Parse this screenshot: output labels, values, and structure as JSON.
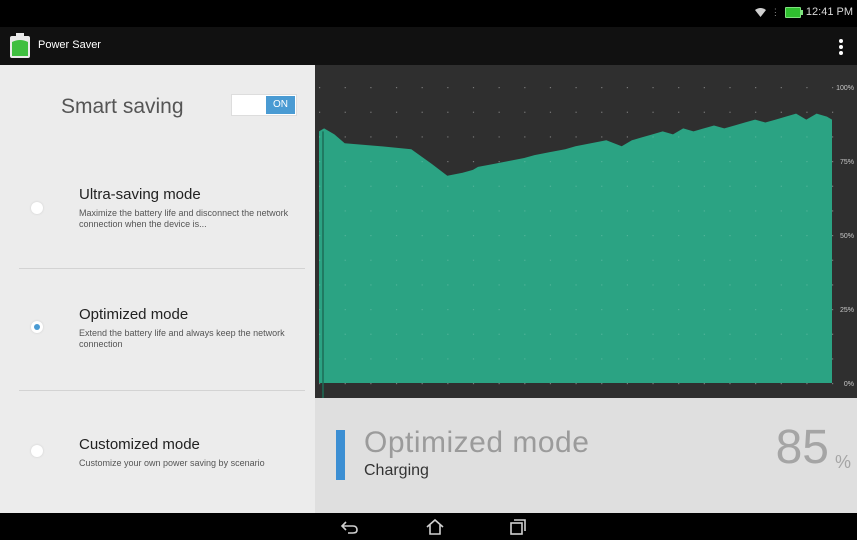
{
  "status_bar": {
    "time": "12:41 PM",
    "icons": [
      "wifi-icon",
      "battery-charging-icon"
    ]
  },
  "app": {
    "title": "Power Saver",
    "icon": "battery-app-icon"
  },
  "smart_saving": {
    "label": "Smart saving",
    "toggle_label": "ON",
    "enabled": true
  },
  "modes": [
    {
      "title": "Ultra-saving mode",
      "description": "Maximize the battery life and disconnect the network connection when the device is...",
      "selected": false
    },
    {
      "title": "Optimized mode",
      "description": "Extend the battery life and always keep the network connection",
      "selected": true
    },
    {
      "title": "Customized mode",
      "description": "Customize your own power saving by scenario",
      "selected": false
    }
  ],
  "chart_data": {
    "type": "area",
    "y_ticks": [
      "100%",
      "75%",
      "50%",
      "25%",
      "0%"
    ],
    "ylim": [
      0,
      100
    ],
    "xlim": [
      0,
      100
    ],
    "grid": true,
    "series": [
      {
        "x": [
          0,
          1,
          3,
          5,
          12,
          18,
          22,
          25,
          28,
          30,
          31,
          34,
          37,
          40,
          42,
          45,
          48,
          50,
          53,
          56,
          59,
          61,
          63,
          65,
          67,
          69,
          71,
          73,
          75,
          77,
          79,
          81,
          83,
          85,
          87,
          89,
          91,
          93,
          95,
          97,
          99,
          100
        ],
        "values": [
          85,
          86,
          84,
          81,
          80,
          79,
          74,
          70,
          71,
          72,
          73,
          74,
          75,
          76,
          77,
          78,
          79,
          80,
          81,
          82,
          80,
          82,
          83,
          84,
          85,
          84,
          86,
          85,
          86,
          87,
          86,
          87,
          88,
          89,
          88,
          89,
          90,
          91,
          89,
          91,
          90,
          89
        ],
        "color": "#2ba383"
      }
    ]
  },
  "summary": {
    "mode": "Optimized mode",
    "status": "Charging",
    "percent": "85",
    "percent_sign": "%",
    "accent": "#3c8fd3"
  },
  "nav": {
    "buttons": [
      "back-icon",
      "home-icon",
      "recent-apps-icon"
    ]
  },
  "colors": {
    "accent": "#4a9bd3",
    "chart_fill": "#2ba383",
    "chart_bg": "#2f2f2f"
  }
}
